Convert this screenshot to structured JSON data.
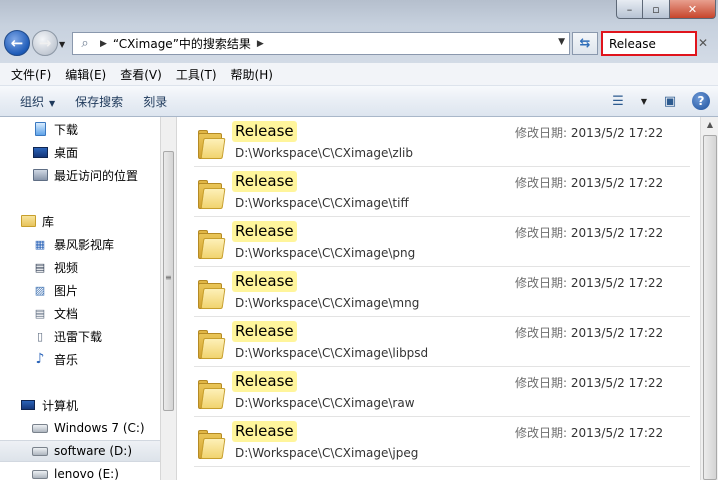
{
  "window": {
    "minimize_glyph": "–",
    "maximize_glyph": "▫",
    "close_glyph": "✕"
  },
  "address": {
    "breadcrumb": "“CXimage”中的搜索结果",
    "search_value": "Release"
  },
  "menu": [
    "文件(F)",
    "编辑(E)",
    "查看(V)",
    "工具(T)",
    "帮助(H)"
  ],
  "toolbar": {
    "organize": "组织",
    "save_search": "保存搜索",
    "burn": "刻录"
  },
  "nav": {
    "downloads": "下载",
    "desktop": "桌面",
    "recent": "最近访问的位置",
    "libraries": "库",
    "baofeng": "暴风影视库",
    "videos": "视频",
    "pictures": "图片",
    "documents": "文档",
    "thunder": "迅雷下载",
    "music": "音乐",
    "computer": "计算机",
    "drive_c": "Windows 7 (C:)",
    "drive_d": "software (D:)",
    "drive_e": "lenovo (E:)"
  },
  "results": [
    {
      "name": "Release",
      "path": "D:\\Workspace\\C\\CXimage\\zlib",
      "date_label": "修改日期:",
      "date": "2013/5/2 17:22"
    },
    {
      "name": "Release",
      "path": "D:\\Workspace\\C\\CXimage\\tiff",
      "date_label": "修改日期:",
      "date": "2013/5/2 17:22"
    },
    {
      "name": "Release",
      "path": "D:\\Workspace\\C\\CXimage\\png",
      "date_label": "修改日期:",
      "date": "2013/5/2 17:22"
    },
    {
      "name": "Release",
      "path": "D:\\Workspace\\C\\CXimage\\mng",
      "date_label": "修改日期:",
      "date": "2013/5/2 17:22"
    },
    {
      "name": "Release",
      "path": "D:\\Workspace\\C\\CXimage\\libpsd",
      "date_label": "修改日期:",
      "date": "2013/5/2 17:22"
    },
    {
      "name": "Release",
      "path": "D:\\Workspace\\C\\CXimage\\raw",
      "date_label": "修改日期:",
      "date": "2013/5/2 17:22"
    },
    {
      "name": "Release",
      "path": "D:\\Workspace\\C\\CXimage\\jpeg",
      "date_label": "修改日期:",
      "date": "2013/5/2 17:22"
    }
  ],
  "colors": {
    "search_highlight": "#e0141c",
    "match_highlight": "#fff59c"
  }
}
